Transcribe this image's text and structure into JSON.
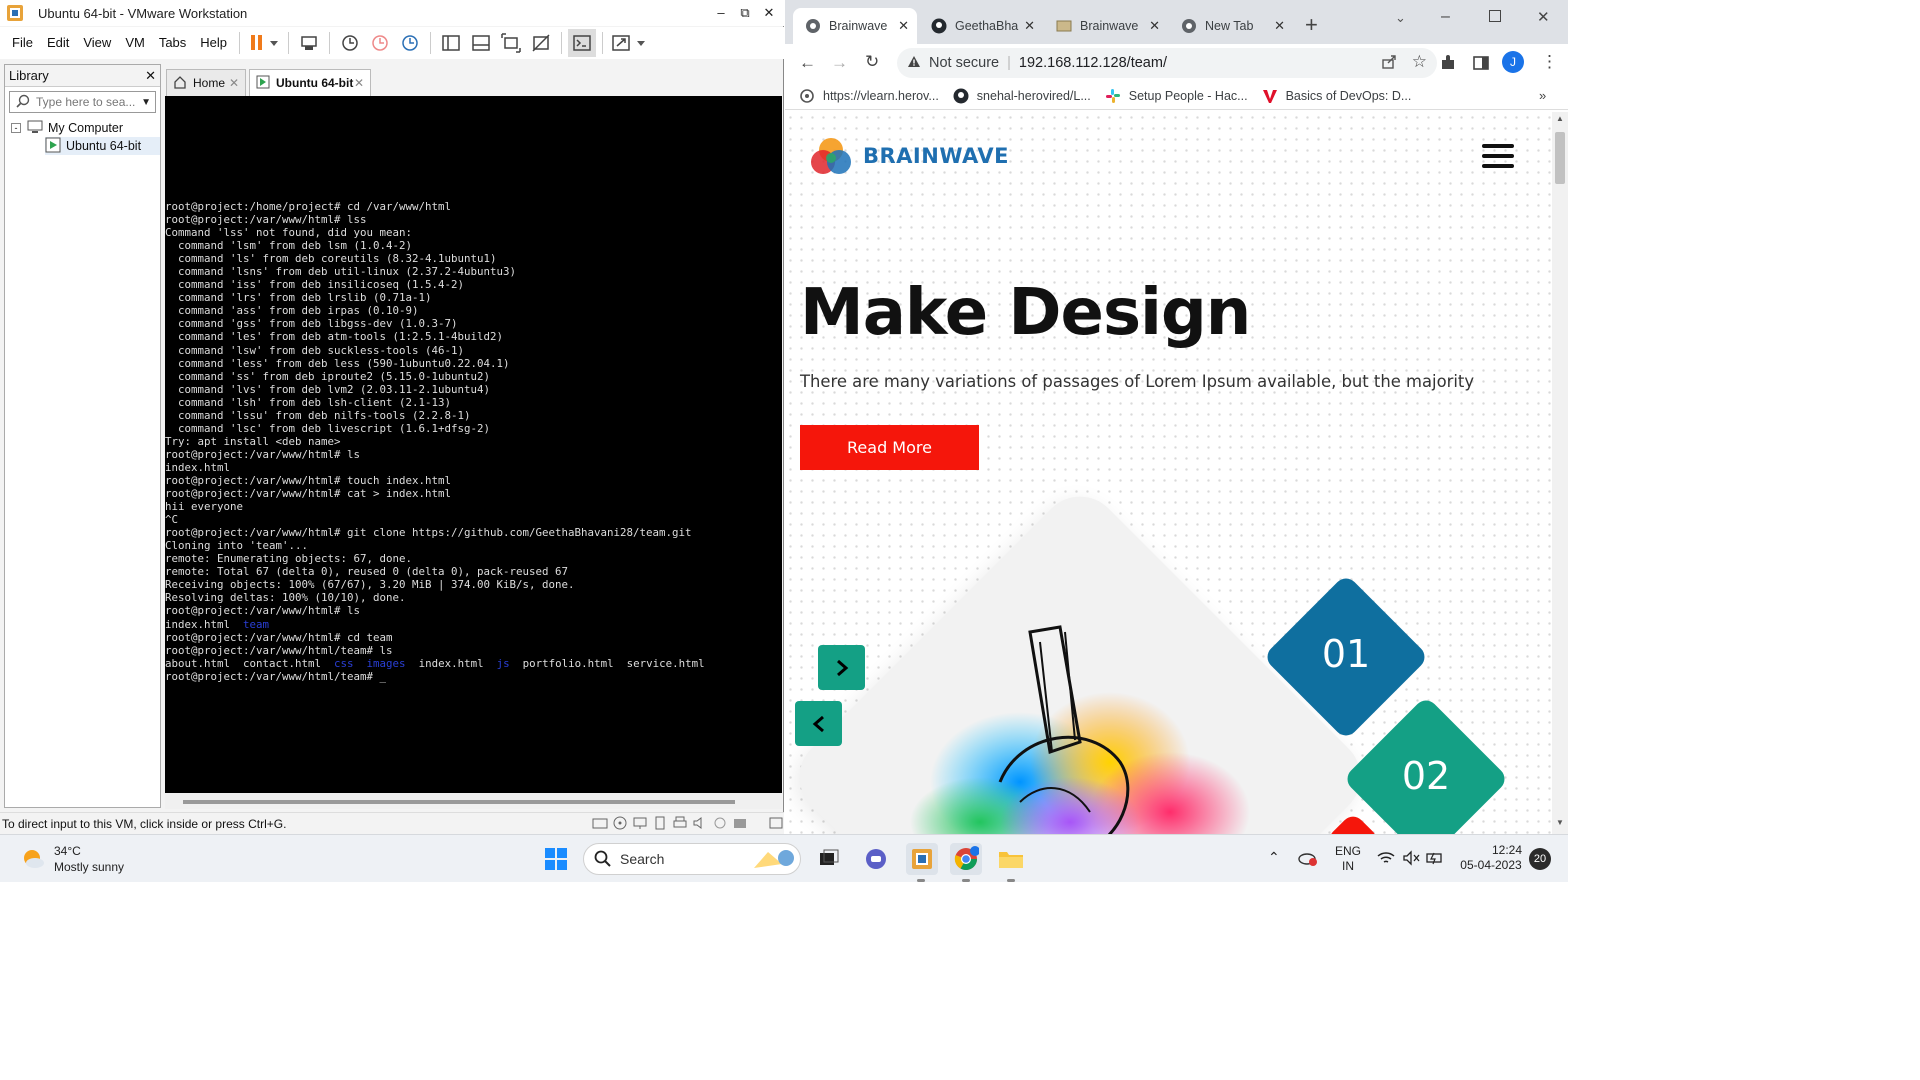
{
  "vmware": {
    "title": "Ubuntu 64-bit - VMware Workstation",
    "menu": [
      "File",
      "Edit",
      "View",
      "VM",
      "Tabs",
      "Help"
    ],
    "library_label": "Library",
    "search_placeholder": "Type here to sea...",
    "tree": {
      "root": "My Computer",
      "child": "Ubuntu 64-bit"
    },
    "tabs": [
      {
        "label": "Home"
      },
      {
        "label": "Ubuntu 64-bit"
      }
    ],
    "status_text": "To direct input to this VM, click inside or press Ctrl+G.",
    "terminal": [
      [
        {
          "t": "root@project:/home/project# cd /var/www/html"
        }
      ],
      [
        {
          "t": "root@project:/var/www/html# lss"
        }
      ],
      [
        {
          "t": "Command 'lss' not found, did you mean:"
        }
      ],
      [
        {
          "t": "  command 'lsm' from deb lsm (1.0.4-2)"
        }
      ],
      [
        {
          "t": "  command 'ls' from deb coreutils (8.32-4.1ubuntu1)"
        }
      ],
      [
        {
          "t": "  command 'lsns' from deb util-linux (2.37.2-4ubuntu3)"
        }
      ],
      [
        {
          "t": "  command 'iss' from deb insilicoseq (1.5.4-2)"
        }
      ],
      [
        {
          "t": "  command 'lrs' from deb lrslib (0.71a-1)"
        }
      ],
      [
        {
          "t": "  command 'ass' from deb irpas (0.10-9)"
        }
      ],
      [
        {
          "t": "  command 'gss' from deb libgss-dev (1.0.3-7)"
        }
      ],
      [
        {
          "t": "  command 'les' from deb atm-tools (1:2.5.1-4build2)"
        }
      ],
      [
        {
          "t": "  command 'lsw' from deb suckless-tools (46-1)"
        }
      ],
      [
        {
          "t": "  command 'less' from deb less (590-1ubuntu0.22.04.1)"
        }
      ],
      [
        {
          "t": "  command 'ss' from deb iproute2 (5.15.0-1ubuntu2)"
        }
      ],
      [
        {
          "t": "  command 'lvs' from deb lvm2 (2.03.11-2.1ubuntu4)"
        }
      ],
      [
        {
          "t": "  command 'lsh' from deb lsh-client (2.1-13)"
        }
      ],
      [
        {
          "t": "  command 'lssu' from deb nilfs-tools (2.2.8-1)"
        }
      ],
      [
        {
          "t": "  command 'lsc' from deb livescript (1.6.1+dfsg-2)"
        }
      ],
      [
        {
          "t": "Try: apt install <deb name>"
        }
      ],
      [
        {
          "t": "root@project:/var/www/html# ls"
        }
      ],
      [
        {
          "t": "index.html"
        }
      ],
      [
        {
          "t": "root@project:/var/www/html# touch index.html"
        }
      ],
      [
        {
          "t": "root@project:/var/www/html# cat > index.html"
        }
      ],
      [
        {
          "t": "hii everyone"
        }
      ],
      [
        {
          "t": "^C"
        }
      ],
      [
        {
          "t": "root@project:/var/www/html# git clone https://github.com/GeethaBhavani28/team.git"
        }
      ],
      [
        {
          "t": "Cloning into 'team'..."
        }
      ],
      [
        {
          "t": "remote: Enumerating objects: 67, done."
        }
      ],
      [
        {
          "t": "remote: Total 67 (delta 0), reused 0 (delta 0), pack-reused 67"
        }
      ],
      [
        {
          "t": "Receiving objects: 100% (67/67), 3.20 MiB | 374.00 KiB/s, done."
        }
      ],
      [
        {
          "t": "Resolving deltas: 100% (10/10), done."
        }
      ],
      [
        {
          "t": "root@project:/var/www/html# ls"
        }
      ],
      [
        {
          "t": "index.html  "
        },
        {
          "t": "team",
          "c": "dir"
        }
      ],
      [
        {
          "t": "root@project:/var/www/html# cd team"
        }
      ],
      [
        {
          "t": "root@project:/var/www/html/team# ls"
        }
      ],
      [
        {
          "t": "about.html  contact.html  "
        },
        {
          "t": "css",
          "c": "dir"
        },
        {
          "t": "  "
        },
        {
          "t": "images",
          "c": "dir"
        },
        {
          "t": "  index.html  "
        },
        {
          "t": "js",
          "c": "dir"
        },
        {
          "t": "  portfolio.html  service.html"
        }
      ],
      [
        {
          "t": "root@project:/var/www/html/team# "
        },
        {
          "t": "_",
          "c": "cursor"
        }
      ]
    ]
  },
  "chrome": {
    "tabs": [
      {
        "label": "Brainwave",
        "icon": "chrome-icon",
        "active": true
      },
      {
        "label": "GeethaBha",
        "icon": "github-icon",
        "active": false
      },
      {
        "label": "Brainwave",
        "icon": "page-icon",
        "active": false
      },
      {
        "label": "New Tab",
        "icon": "chrome-icon",
        "active": false
      }
    ],
    "security_label": "Not secure",
    "url": "192.168.112.128/team/",
    "profile_initial": "J",
    "bookmarks": [
      {
        "label": "https://vlearn.herov...",
        "icon": "site-icon"
      },
      {
        "label": "snehal-herovired/L...",
        "icon": "github-icon"
      },
      {
        "label": "Setup People - Hac...",
        "icon": "slack-icon"
      },
      {
        "label": "Basics of DevOps: D...",
        "icon": "v-icon"
      }
    ]
  },
  "site": {
    "brand": "BRAINWAVE",
    "headline": "Make Design",
    "subtext": "There are many variations of passages of Lorem Ipsum available, but the majority",
    "cta": "Read More",
    "diamond_1": "01",
    "diamond_2": "02"
  },
  "taskbar": {
    "weather_temp": "34°C",
    "weather_desc": "Mostly sunny",
    "search_label": "Search",
    "lang_1": "ENG",
    "lang_2": "IN",
    "time": "12:24",
    "date": "05-04-2023",
    "notifications": "20"
  },
  "colors": {
    "accent": "#1f6fb0",
    "cta": "#f5160b",
    "teal": "#14a085",
    "blue_diamond": "#0f6f9f"
  }
}
